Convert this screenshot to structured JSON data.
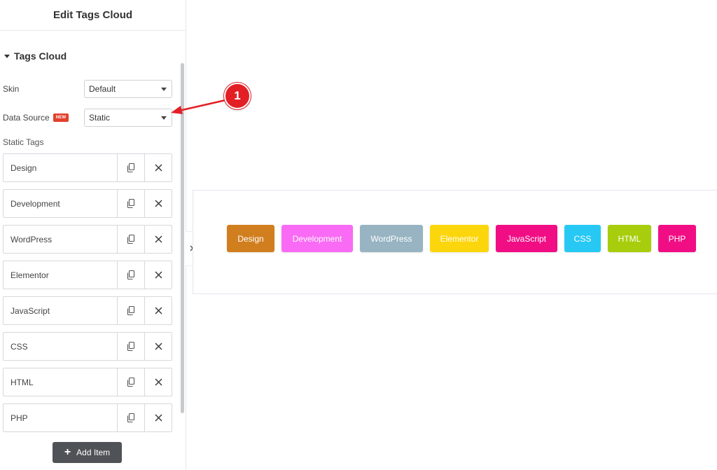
{
  "panel": {
    "title": "Edit Tags Cloud",
    "section_title": "Tags Cloud",
    "skin": {
      "label": "Skin",
      "value": "Default"
    },
    "data_source": {
      "label": "Data Source",
      "badge": "NEW",
      "value": "Static"
    },
    "static_tags_label": "Static Tags",
    "items": [
      {
        "title": "Design"
      },
      {
        "title": "Development"
      },
      {
        "title": "WordPress"
      },
      {
        "title": "Elementor"
      },
      {
        "title": "JavaScript"
      },
      {
        "title": "CSS"
      },
      {
        "title": "HTML"
      },
      {
        "title": "PHP"
      }
    ],
    "add_item_label": "Add Item"
  },
  "preview": {
    "tags": [
      {
        "label": "Design",
        "color": "#d17f1e"
      },
      {
        "label": "Development",
        "color": "#f96bf4"
      },
      {
        "label": "WordPress",
        "color": "#98b4c2"
      },
      {
        "label": "Elementor",
        "color": "#fcd60d"
      },
      {
        "label": "JavaScript",
        "color": "#f10e85"
      },
      {
        "label": "CSS",
        "color": "#27c9f4"
      },
      {
        "label": "HTML",
        "color": "#a7cd0d"
      },
      {
        "label": "PHP",
        "color": "#f10e85"
      }
    ]
  },
  "annotation": {
    "number": "1",
    "color": "#e31f26"
  },
  "icons": [
    "caret-down-icon",
    "dropdown-caret-icon",
    "copy-icon",
    "close-icon",
    "plus-icon",
    "chevron-right-icon"
  ]
}
